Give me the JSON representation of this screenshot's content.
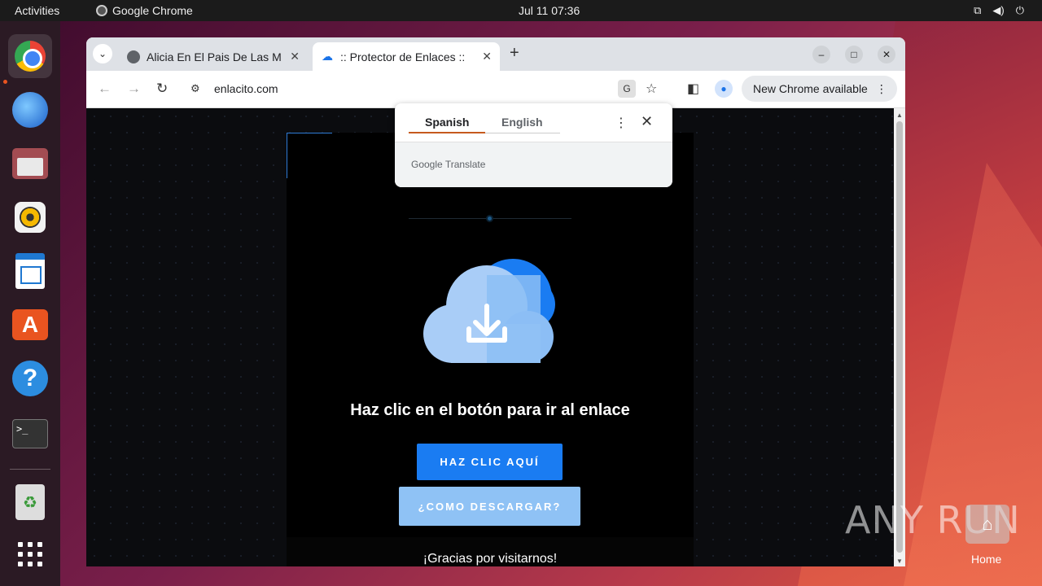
{
  "topbar": {
    "activities": "Activities",
    "app_name": "Google Chrome",
    "clock": "Jul 11  07:36"
  },
  "dock": {
    "items": [
      "chrome",
      "thunderbird",
      "files",
      "rhythmbox",
      "writer",
      "app-center",
      "help",
      "terminal",
      "trash",
      "show-apps"
    ]
  },
  "browser": {
    "tabs": [
      {
        "title": "Alicia En El Pais De Las M",
        "icon": "globe-icon",
        "active": false
      },
      {
        "title": ":: Protector de Enlaces ::",
        "icon": "cloud-download-icon",
        "active": true
      }
    ],
    "new_tab": "+",
    "url": "enlacito.com",
    "update_button": "New Chrome available"
  },
  "translate_popup": {
    "tab_source": "Spanish",
    "tab_target": "English",
    "brand_google": "Google",
    "brand_translate": "Translate"
  },
  "page": {
    "headline": "Haz clic en el botón para ir al enlace",
    "primary_button": "HAZ CLIC AQUÍ",
    "secondary_button": "¿COMO DESCARGAR?",
    "footer_text": "¡Gracias por visitarnos!"
  },
  "desktop": {
    "watermark": "ANY RUN",
    "home_label": "Home"
  },
  "colors": {
    "accent_blue": "#1a7cf2",
    "secondary_blue": "#8fc2f5",
    "page_bg": "#0b0c0f",
    "translate_underline": "#c65a1e"
  }
}
